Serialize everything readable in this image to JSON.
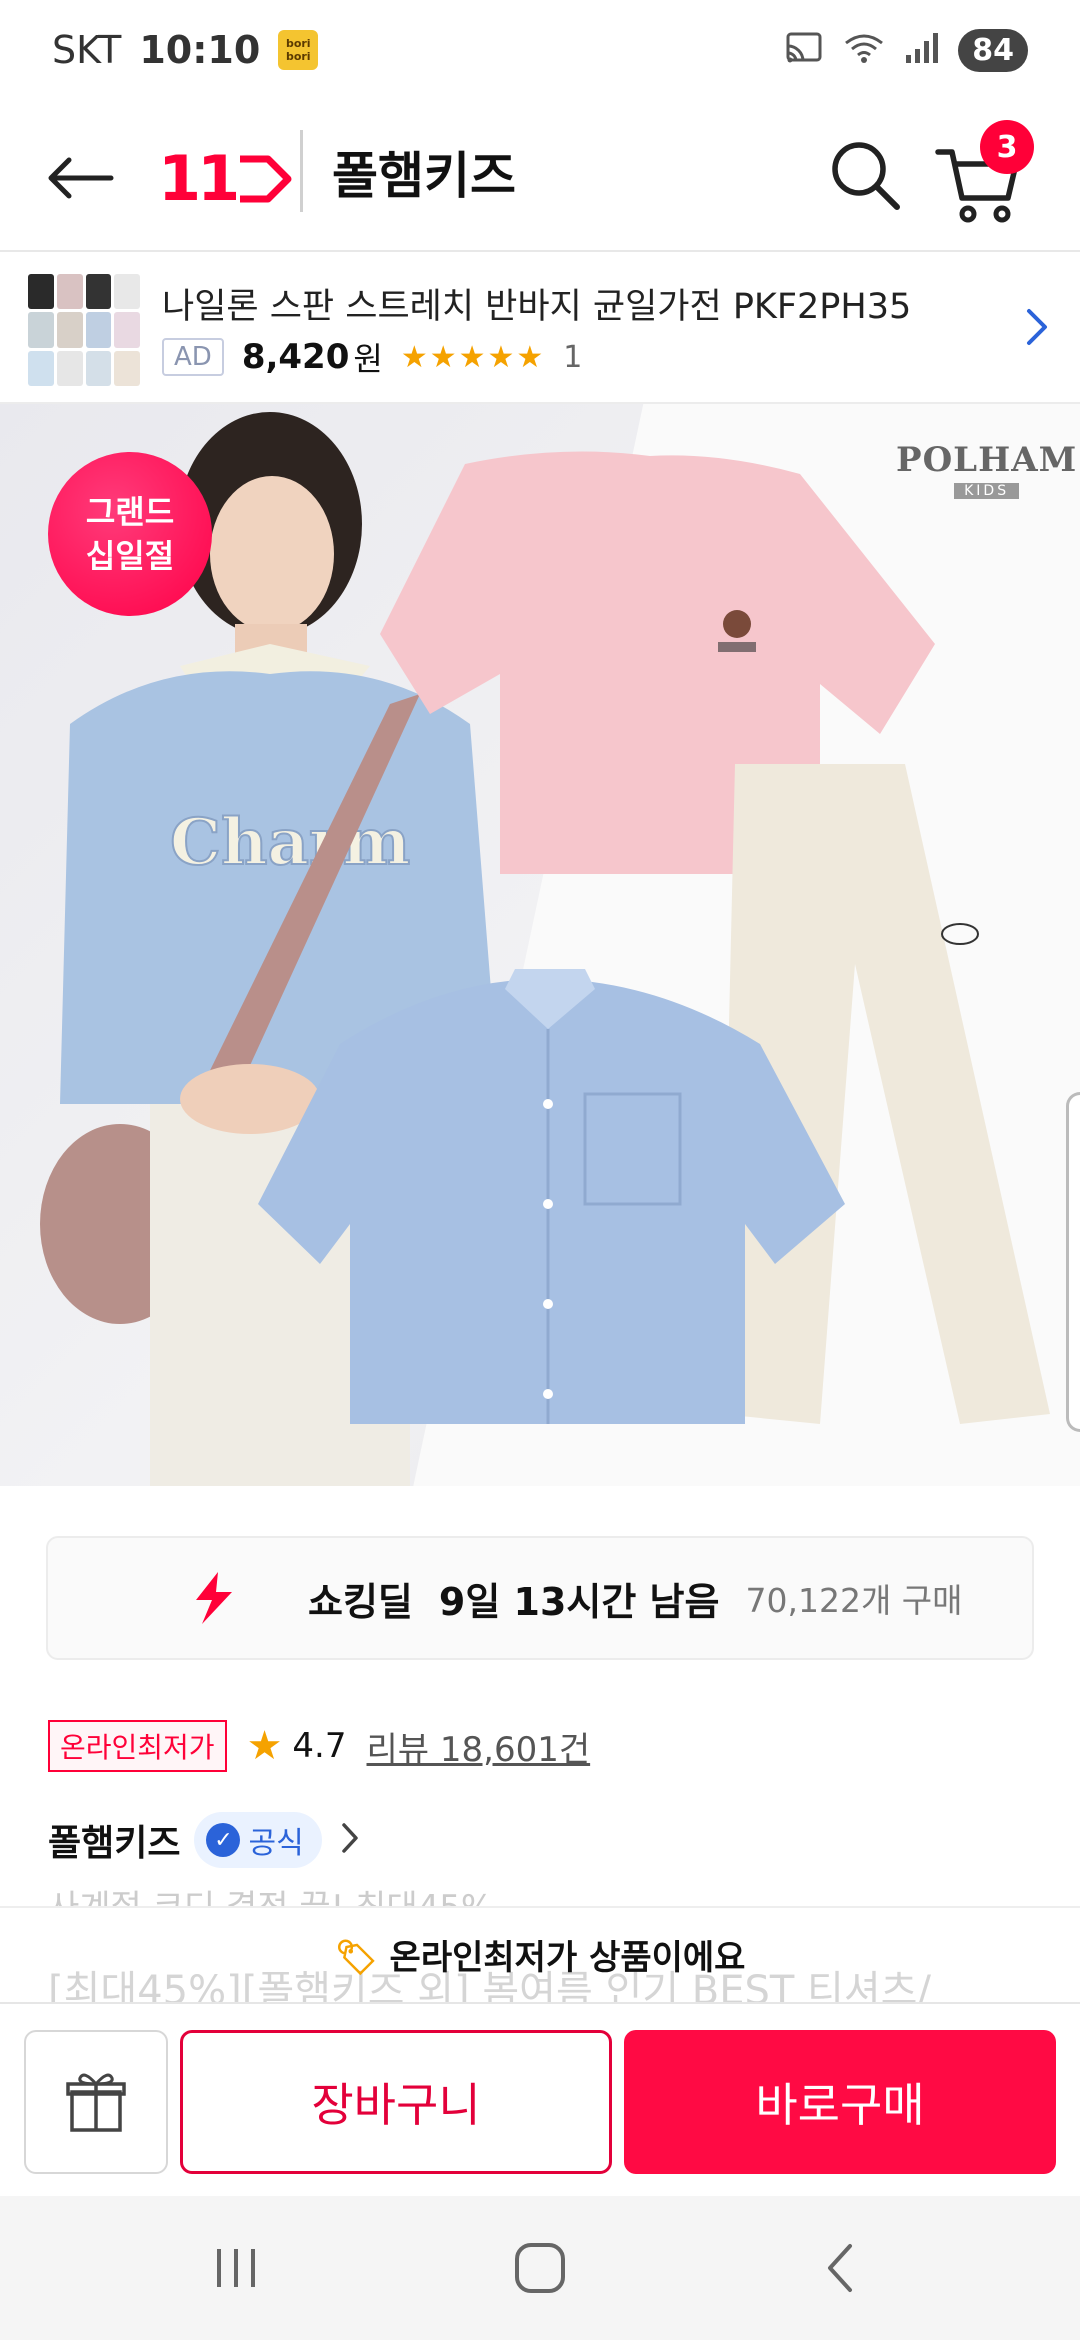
{
  "status_bar": {
    "carrier": "SKT",
    "time": "10:10",
    "app_badge": "bori bori",
    "battery": "84"
  },
  "header": {
    "logo": "11",
    "store_name": "폴햄키즈",
    "cart_count": "3"
  },
  "ad": {
    "title": "나일론 스판 스트레치 반바지 균일가전  PKF2PH35",
    "badge": "AD",
    "price": "8,420",
    "price_unit": "원",
    "stars": "★★★★★",
    "review_count": "1"
  },
  "product_image": {
    "badge_line1": "그랜드",
    "badge_line2": "십일절",
    "brand_line1": "POLHAM",
    "brand_line2": "KIDS"
  },
  "deal": {
    "label": "쇼킹딜",
    "time_left": "9일 13시간 남음",
    "purchase_count": "70,122개 구매"
  },
  "rating": {
    "lowest_badge": "온라인최저가",
    "score": "4.7",
    "reviews": "리뷰 18,601건"
  },
  "seller": {
    "name": "폴햄키즈",
    "official": "공식"
  },
  "cut_text": "사계절 코디 결정 끝! 최대45%",
  "banner": {
    "faded_text": "[최대45%][폴햄키즈 외] 봄여름 인기 BEST 티셔츠/",
    "main_text": "온라인최저가 상품이에요"
  },
  "actions": {
    "cart_label": "장바구니",
    "buy_label": "바로구매"
  },
  "colors": {
    "accent": "#ff0038",
    "star": "#f5a200",
    "official": "#2b63d9"
  }
}
